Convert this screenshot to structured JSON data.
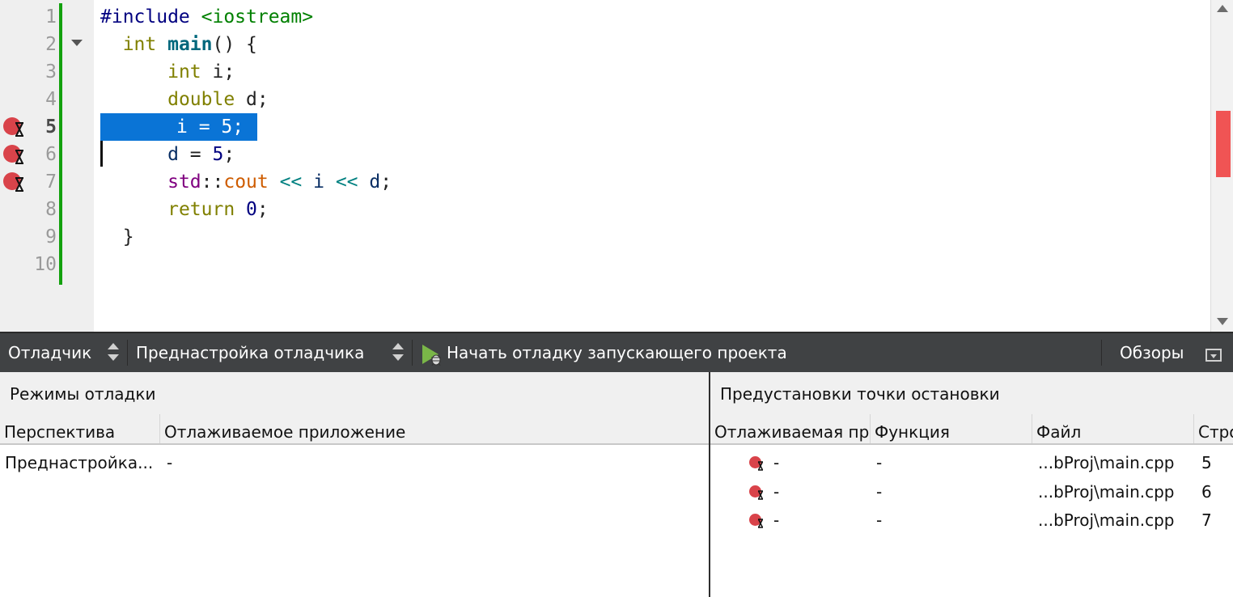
{
  "editor": {
    "line_numbers": [
      "1",
      "2",
      "3",
      "4",
      "5",
      "6",
      "7",
      "8",
      "9",
      "10"
    ],
    "current_line": "5",
    "lines": {
      "l1": {
        "pp": "#include ",
        "inc": "<iostream>"
      },
      "l2": {
        "indent": "  ",
        "kw": "int",
        "sp": " ",
        "fn": "main",
        "rest": "() {"
      },
      "l3": {
        "indent": "      ",
        "kw": "int",
        "rest": " i;"
      },
      "l4": {
        "indent": "      ",
        "kw": "double",
        "rest": " d;"
      },
      "l5": {
        "selected": "i = 5;"
      },
      "l6": {
        "indent": "      ",
        "v": "d",
        "eq": " = ",
        "num": "5",
        "end": ";"
      },
      "l7": {
        "indent": "      ",
        "ns": "std",
        "sep": "::",
        "str": "cout",
        "op1": " << ",
        "v1": "i",
        "op2": " << ",
        "v2": "d",
        "end": ";"
      },
      "l8": {
        "indent": "      ",
        "kw": "return",
        "sp": " ",
        "num": "0",
        "end": ";"
      },
      "l9": {
        "indent": "  ",
        "rest": "}"
      }
    },
    "breakpoint_lines": [
      "5",
      "6",
      "7"
    ]
  },
  "toolbar": {
    "debugger_label": "Отладчик",
    "preset_label": "Преднастройка отладчика",
    "start_label": "Начать отладку запускающего проекта",
    "views_label": "Обзоры"
  },
  "debug_modes": {
    "title": "Режимы отладки",
    "columns": [
      "Перспектива",
      "Отлаживаемое приложение"
    ],
    "rows": [
      {
        "perspective": "Преднастройка...",
        "app": "-"
      }
    ]
  },
  "breakpoint_presets": {
    "title": "Предустановки точки остановки",
    "columns": [
      "Отлаживаемая пр",
      "Функция",
      "Файл",
      "Стро"
    ],
    "rows": [
      {
        "app": "-",
        "function": "-",
        "file": "...bProj\\main.cpp",
        "line": "5"
      },
      {
        "app": "-",
        "function": "-",
        "file": "...bProj\\main.cpp",
        "line": "6"
      },
      {
        "app": "-",
        "function": "-",
        "file": "...bProj\\main.cpp",
        "line": "7"
      }
    ]
  },
  "colors": {
    "selection": "#0a74d6",
    "breakpoint": "#d9434a",
    "change_bar": "#13a10e",
    "toolbar_bg": "#404244"
  },
  "icons": {
    "breakpoint": "breakpoint-hourglass-icon",
    "start": "start-debug-icon",
    "fold": "fold-arrow-icon"
  }
}
